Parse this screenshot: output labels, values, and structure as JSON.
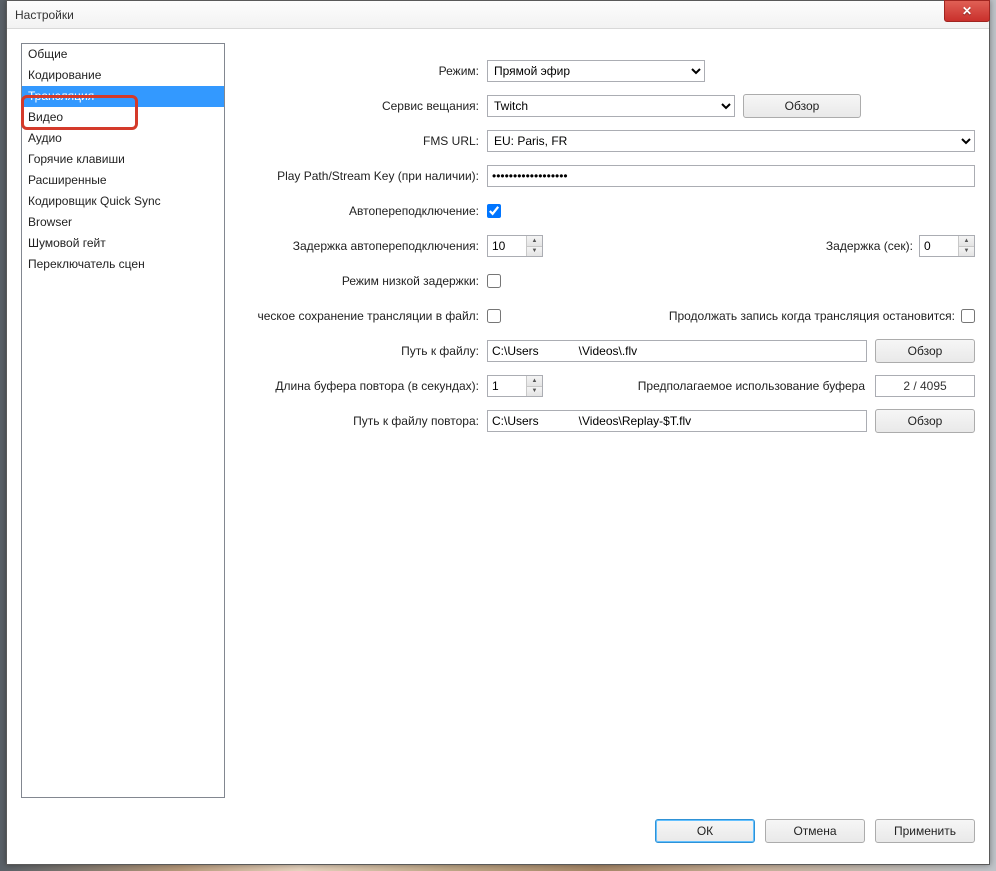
{
  "window": {
    "title": "Настройки"
  },
  "sidebar": {
    "items": [
      "Общие",
      "Кодирование",
      "Трансляция",
      "Видео",
      "Аудио",
      "Горячие клавиши",
      "Расширенные",
      "Кодировщик Quick Sync",
      "Browser",
      "Шумовой гейт",
      "Переключатель сцен"
    ],
    "selected_index": 2
  },
  "form": {
    "mode": {
      "label": "Режим:",
      "value": "Прямой эфир"
    },
    "service": {
      "label": "Сервис вещания:",
      "value": "Twitch",
      "browse": "Обзор"
    },
    "fms": {
      "label": "FMS URL:",
      "value": "EU: Paris, FR"
    },
    "streamkey": {
      "label": "Play Path/Stream Key (при наличии):",
      "value": "••••••••••••••••••"
    },
    "autoreconnect": {
      "label": "Автопереподключение:",
      "checked": true
    },
    "reconnect_delay": {
      "label": "Задержка автопереподключения:",
      "value": "10"
    },
    "delay_sec": {
      "label": "Задержка (сек):",
      "value": "0"
    },
    "low_latency": {
      "label": "Режим низкой задержки:",
      "checked": false
    },
    "save_to_file": {
      "label": "ческое сохранение трансляции в файл:",
      "checked": false
    },
    "continue_record": {
      "label": "Продолжать запись когда трансляция остановится:",
      "checked": false
    },
    "file_path": {
      "label": "Путь к файлу:",
      "value": "C:\\Users            \\Videos\\.flv",
      "browse": "Обзор"
    },
    "replay_buffer": {
      "label": "Длина буфера повтора (в секундах):",
      "value": "1"
    },
    "buffer_usage": {
      "label": "Предполагаемое использование буфера",
      "value": "2 / 4095"
    },
    "replay_path": {
      "label": "Путь к файлу повтора:",
      "value": "C:\\Users            \\Videos\\Replay-$T.flv",
      "browse": "Обзор"
    }
  },
  "footer": {
    "ok": "ОК",
    "cancel": "Отмена",
    "apply": "Применить"
  }
}
